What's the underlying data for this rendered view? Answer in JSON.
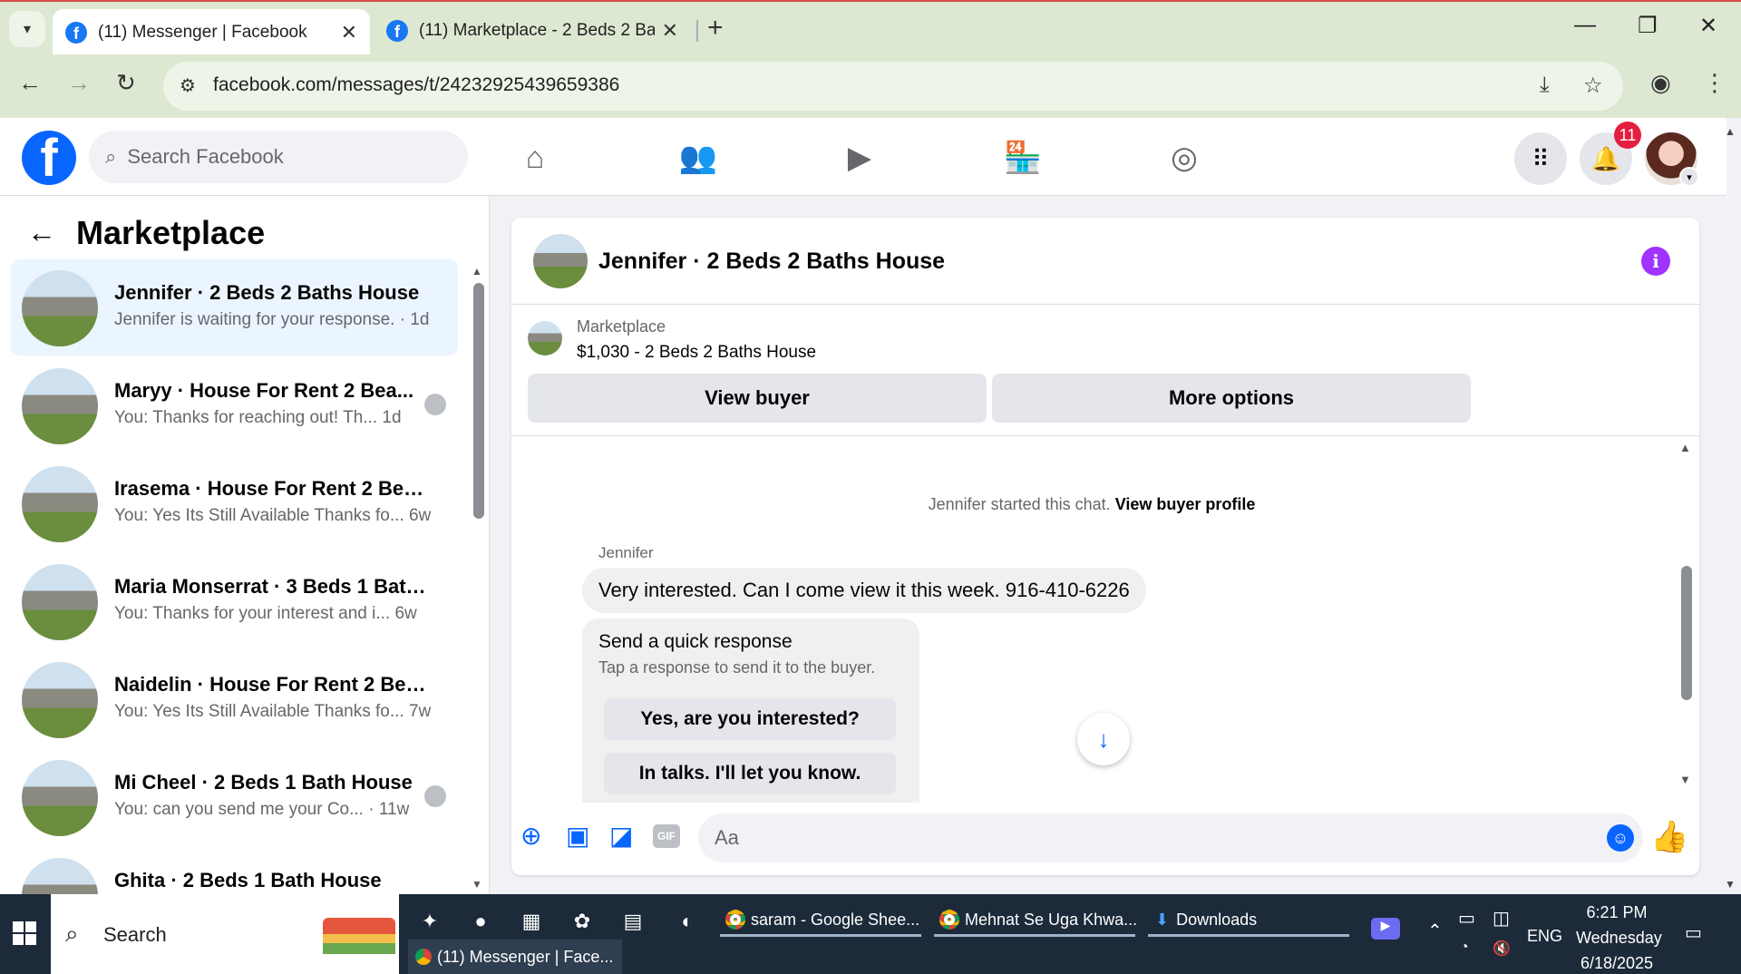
{
  "browser": {
    "tabs": [
      {
        "label": "(11) Messenger | Facebook",
        "close": "✕"
      },
      {
        "label": "(11) Marketplace - 2 Beds 2 Bat",
        "close": "✕"
      }
    ],
    "new_tab": "+",
    "url": "facebook.com/messages/t/24232925439659386"
  },
  "fb": {
    "logo": "f",
    "search_placeholder": "Search Facebook",
    "notifications_count": "11"
  },
  "left": {
    "title": "Marketplace",
    "conversations": [
      {
        "name": "Jennifer · 2 Beds 2 Baths House",
        "preview": "Jennifer is waiting for your response. · 1d",
        "seen": false
      },
      {
        "name": "Maryy · House For Rent 2 Bea...",
        "preview": "You: Thanks for reaching out! Th...   1d",
        "seen": true
      },
      {
        "name": "Irasema · House For Rent 2 Bead...",
        "preview": "You: Yes Its Still Available Thanks fo...   6w",
        "seen": false
      },
      {
        "name": "Maria Monserrat · 3 Beds 1 Bath ...",
        "preview": "You: Thanks for your interest and i...   6w",
        "seen": false
      },
      {
        "name": "Naidelin · House For Rent 2 Bea...",
        "preview": "You: Yes Its Still Available Thanks fo...   7w",
        "seen": false
      },
      {
        "name": "Mi Cheel · 2 Beds 1 Bath House",
        "preview": "You: can you send me your Co...  · 11w",
        "seen": true
      },
      {
        "name": "Ghita · 2 Beds 1 Bath House",
        "preview": "",
        "seen": false
      }
    ]
  },
  "chat": {
    "title": "Jennifer · 2 Beds 2 Baths House",
    "info_icon": "i",
    "listing_label": "Marketplace",
    "listing_price": "$1,030 - 2 Beds 2 Baths House",
    "view_buyer": "View buyer",
    "more_options": "More options",
    "started_text": "Jennifer started this chat.",
    "started_link": "View buyer profile",
    "sender": "Jennifer",
    "message": "Very interested. Can I come view it this week. 916-410-6226",
    "quick_title": "Send a quick response",
    "quick_sub": "Tap a response to send it to the buyer.",
    "quick_options": [
      "Yes, are you interested?",
      "In talks. I'll let you know."
    ],
    "input_placeholder": "Aa"
  },
  "taskbar": {
    "search_label": "Search",
    "apps": [
      {
        "label": "saram - Google Shee..."
      },
      {
        "label": "Mehnat Se Uga Khwa..."
      },
      {
        "label": "Downloads"
      }
    ],
    "active_window": "(11) Messenger | Face...",
    "language": "ENG",
    "time": "6:21 PM",
    "day": "Wednesday",
    "date": "6/18/2025"
  },
  "colors": {
    "fb_blue": "#0866ff",
    "badge_red": "#e41e3f",
    "info_purple": "#a033ff"
  }
}
